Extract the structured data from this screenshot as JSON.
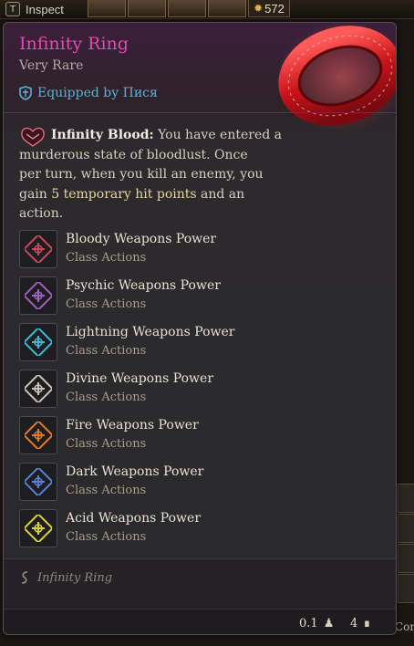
{
  "topbar": {
    "inspect_key": "T",
    "inspect_label": "Inspect",
    "gold_amount": "572"
  },
  "tooltip": {
    "item_name": "Infinity Ring",
    "rarity": "Very Rare",
    "equipped_by": "Equipped by Пися",
    "passive": {
      "title": "Infinity Blood:",
      "line1": "You have entered a",
      "line2": "murderous state of bloodlust. Once",
      "line3": "per turn, when you kill an enemy, you",
      "line4_pre": "gain ",
      "line4_hl": "5 temporary hit points",
      "line4_post": " and an",
      "line5": "action."
    },
    "actions": [
      {
        "name": "Bloody Weapons Power",
        "type": "Class Actions",
        "color": "#c9485c"
      },
      {
        "name": "Psychic Weapons Power",
        "type": "Class Actions",
        "color": "#a05ec4"
      },
      {
        "name": "Lightning Weapons Power",
        "type": "Class Actions",
        "color": "#3ab9d8"
      },
      {
        "name": "Divine Weapons Power",
        "type": "Class Actions",
        "color": "#c9c2b6"
      },
      {
        "name": "Fire Weapons Power",
        "type": "Class Actions",
        "color": "#e27a2a"
      },
      {
        "name": "Dark Weapons Power",
        "type": "Class Actions",
        "color": "#5a7fd8"
      },
      {
        "name": "Acid Weapons Power",
        "type": "Class Actions",
        "color": "#d8d23a"
      }
    ],
    "footer_item": "Infinity Ring",
    "weight": "0.1",
    "value": "4"
  },
  "corner_text": "Con",
  "colors": {
    "item_name": "#e44ab0",
    "equipped": "#5cb2d4",
    "ring": "#e02a2a"
  }
}
